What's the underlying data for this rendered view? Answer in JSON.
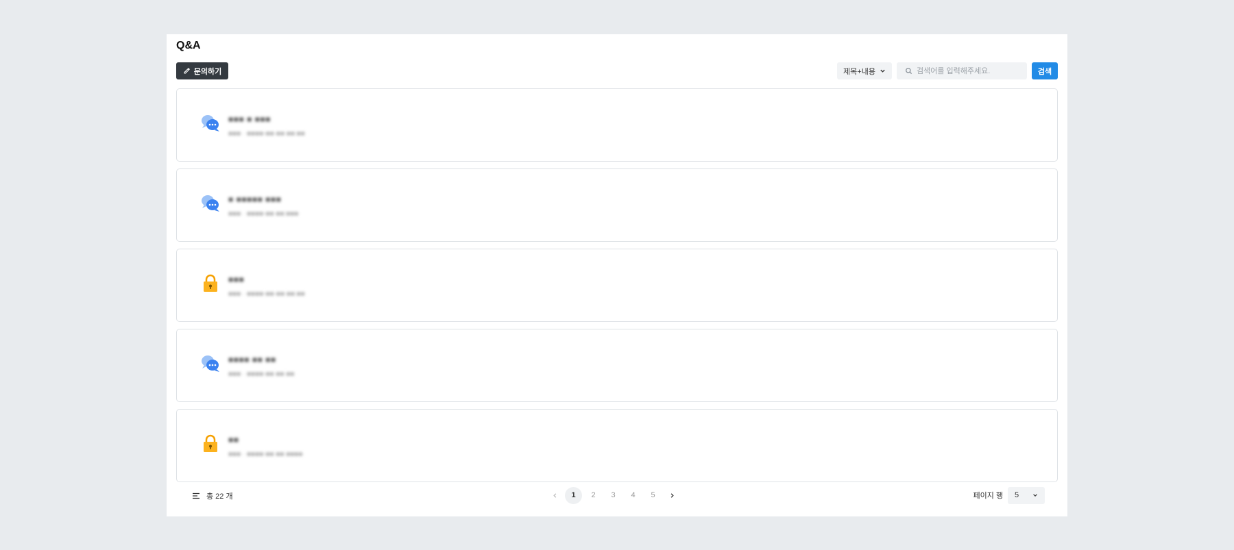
{
  "header": {
    "title": "Q&A"
  },
  "toolbar": {
    "ask_label": "문의하기",
    "search_scope": "제목+내용",
    "search_placeholder": "검색어를 입력해주세요.",
    "search_label": "검색"
  },
  "colors": {
    "primary": "#228be6",
    "dark_button": "#343a40",
    "chat_icon": "#4c8cf0",
    "lock_icon": "#fcb21e",
    "card_border": "#dee2e6"
  },
  "posts": [
    {
      "icon": "chat-bubbles-icon",
      "title": "■■■ ■ ■■■",
      "meta": "■■■ · ■■■■-■■-■■ ■■:■■"
    },
    {
      "icon": "chat-bubbles-icon",
      "title": "■ ■■■■■ ■■■",
      "meta": "■■■ · ■■■■-■■ ■■:■■■"
    },
    {
      "icon": "lock-icon",
      "title": "■■■",
      "meta": "■■■ · ■■■■-■■-■■ ■■:■■"
    },
    {
      "icon": "chat-bubbles-icon",
      "title": "■■■■ ■■ ■■",
      "meta": "■■■ · ■■■■-■■ ■■ ■■"
    },
    {
      "icon": "lock-icon",
      "title": "■■",
      "meta": "■■■ · ■■■■-■■ ■■ ■■■■"
    }
  ],
  "footer": {
    "total_label": "총 22 개",
    "pages": [
      "1",
      "2",
      "3",
      "4",
      "5"
    ],
    "current_page": "1",
    "rows_label": "페이지 행",
    "rows_value": "5"
  }
}
